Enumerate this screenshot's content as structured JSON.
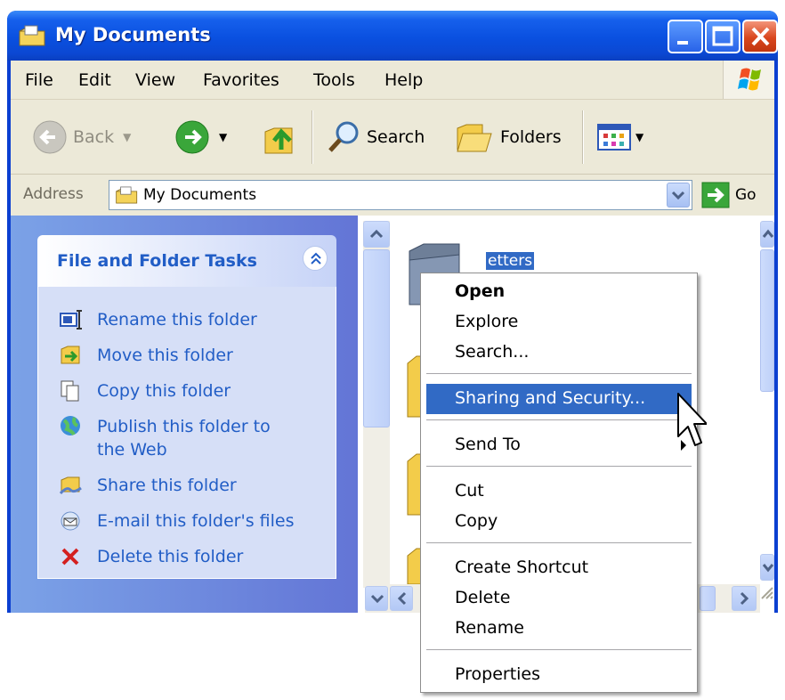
{
  "window": {
    "title": "My Documents",
    "title_icon": "my-documents-icon",
    "buttons": {
      "minimize": "minimize-icon",
      "maximize": "maximize-icon",
      "close": "close-icon"
    }
  },
  "menubar": {
    "items": [
      "File",
      "Edit",
      "View",
      "Favorites",
      "Tools",
      "Help"
    ],
    "logo_icon": "windows-logo-icon"
  },
  "toolbar": {
    "back_label": "Back",
    "search_label": "Search",
    "folders_label": "Folders",
    "icons": [
      "back-arrow-icon",
      "forward-arrow-icon",
      "up-folder-icon",
      "search-icon",
      "folders-icon",
      "views-icon"
    ]
  },
  "address": {
    "label": "Address",
    "value": "My Documents",
    "go_label": "Go"
  },
  "tasks": {
    "header": "File and Folder Tasks",
    "items": [
      {
        "label": "Rename this folder",
        "icon": "rename-icon"
      },
      {
        "label": "Move this folder",
        "icon": "move-icon"
      },
      {
        "label": "Copy this folder",
        "icon": "copy-icon"
      },
      {
        "label": "Publish this folder to the Web",
        "icon": "publish-web-icon"
      },
      {
        "label": "Share this folder",
        "icon": "share-icon"
      },
      {
        "label": "E-mail this folder's files",
        "icon": "email-icon"
      },
      {
        "label": "Delete this folder",
        "icon": "delete-icon"
      }
    ]
  },
  "files": {
    "selected_folder_name": "etters"
  },
  "context_menu": {
    "items": [
      {
        "label": "Open",
        "bold": true
      },
      {
        "label": "Explore"
      },
      {
        "label": "Search..."
      },
      {
        "label": "Sharing and Security...",
        "highlighted": true
      },
      {
        "label": "Send To",
        "submenu": true
      },
      {
        "label": "Cut"
      },
      {
        "label": "Copy"
      },
      {
        "label": "Create Shortcut"
      },
      {
        "label": "Delete"
      },
      {
        "label": "Rename"
      },
      {
        "label": "Properties"
      }
    ]
  },
  "colors": {
    "title_blue": "#0a50e0",
    "highlight": "#316ac5",
    "task_link": "#215dc6",
    "chrome": "#ece9d8"
  }
}
